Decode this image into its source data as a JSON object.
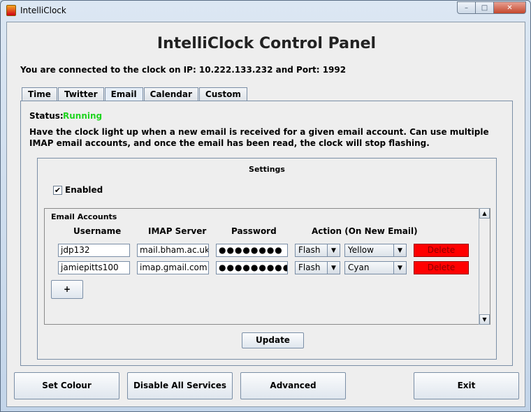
{
  "window": {
    "title": "IntelliClock",
    "minimize_glyph": "–",
    "maximize_glyph": "□",
    "close_glyph": "✕"
  },
  "header": {
    "title": "IntelliClock Control Panel",
    "connection_info": "You are connected to the clock on IP: 10.222.133.232 and Port: 1992"
  },
  "tabs": [
    {
      "label": "Time"
    },
    {
      "label": "Twitter"
    },
    {
      "label": "Email",
      "active": true
    },
    {
      "label": "Calendar"
    },
    {
      "label": "Custom"
    }
  ],
  "email_tab": {
    "status_label": "Status:",
    "status_value": "Running",
    "status_color": "#1ed41e",
    "description": "Have the clock light up when a new email is received for a given email account. Can use multiple IMAP email accounts, and once the email has been read, the clock will stop flashing.",
    "settings": {
      "title": "Settings",
      "enabled_label": "Enabled",
      "enabled": true,
      "check_glyph": "✔",
      "accounts_title": "Email Accounts",
      "columns": {
        "username": "Username",
        "imap_server": "IMAP Server",
        "password": "Password",
        "action": "Action (On New Email)"
      },
      "accounts": [
        {
          "username": "jdp132",
          "imap_server": "mail.bham.ac.uk",
          "password": "●●●●●●●●",
          "action": "Flash",
          "colour": "Yellow",
          "delete_label": "Delete"
        },
        {
          "username": "jamiepitts100",
          "imap_server": "imap.gmail.com",
          "password": "●●●●●●●●●",
          "action": "Flash",
          "colour": "Cyan",
          "delete_label": "Delete"
        }
      ],
      "add_label": "+",
      "update_label": "Update"
    }
  },
  "footer": {
    "set_colour_label": "Set Colour",
    "disable_all_label": "Disable All Services",
    "advanced_label": "Advanced",
    "exit_label": "Exit"
  },
  "colors": {
    "delete_button": "#ff0000",
    "window_frame": "#c3d5e9"
  }
}
